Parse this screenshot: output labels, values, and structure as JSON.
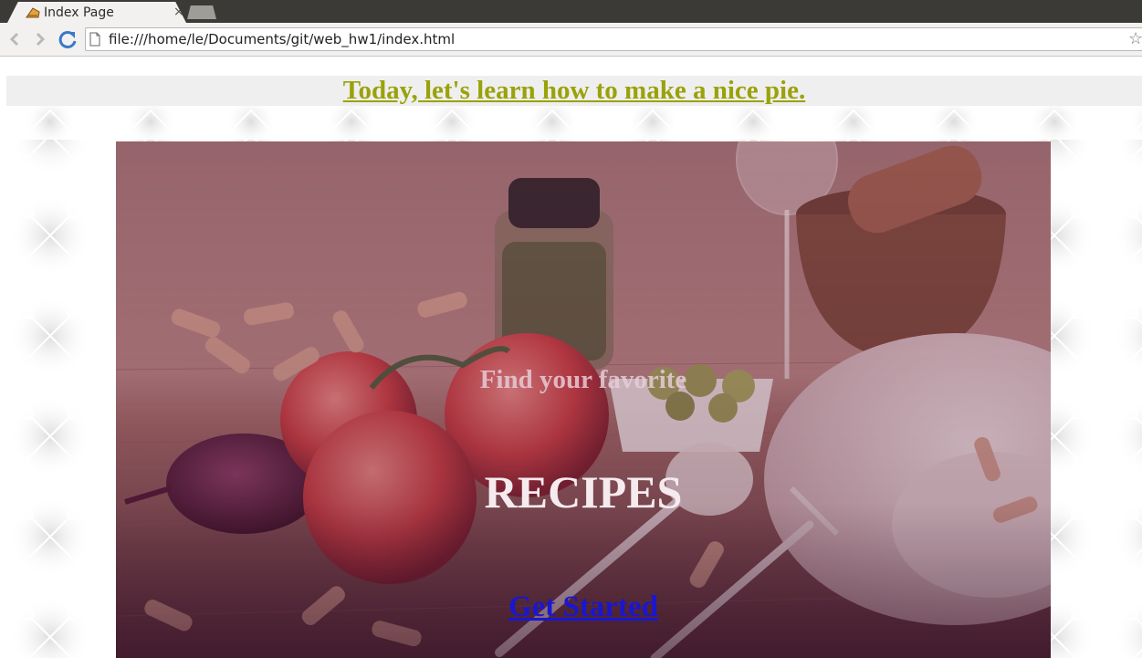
{
  "browser": {
    "tab_title": "Index Page",
    "tab_close": "×",
    "url": "file:///home/le/Documents/git/web_hw1/index.html",
    "icons": [
      "pie-favicon-icon",
      "back-arrow-icon",
      "forward-arrow-icon",
      "reload-icon",
      "page-icon",
      "star-icon"
    ]
  },
  "page": {
    "banner_link": "Today, let's learn how to make a nice pie.",
    "hero": {
      "tagline": "Find your favorite",
      "title": "RECIPES",
      "cta_label": "Get Started"
    },
    "colors": {
      "banner_link": "#9aa20a",
      "banner_bg": "#efefef",
      "cta_link": "#1a16d0",
      "hero_tint": "#7a4a5a"
    }
  }
}
